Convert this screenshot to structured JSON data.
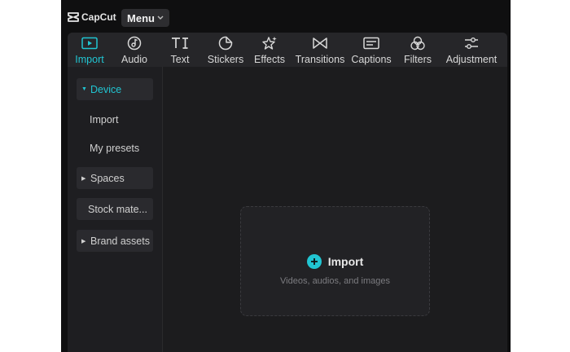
{
  "app": {
    "logo_text": "CapCut",
    "menu_label": "Menu"
  },
  "tabs": [
    {
      "label": "Import",
      "icon": "import-icon",
      "active": true
    },
    {
      "label": "Audio",
      "icon": "audio-icon"
    },
    {
      "label": "Text",
      "icon": "text-icon"
    },
    {
      "label": "Stickers",
      "icon": "stickers-icon"
    },
    {
      "label": "Effects",
      "icon": "effects-icon"
    },
    {
      "label": "Transitions",
      "icon": "transitions-icon"
    },
    {
      "label": "Captions",
      "icon": "captions-icon"
    },
    {
      "label": "Filters",
      "icon": "filters-icon"
    },
    {
      "label": "Adjustment",
      "icon": "adjustment-icon"
    }
  ],
  "sidebar": {
    "items": [
      {
        "label": "Device",
        "expanded": true
      },
      {
        "label": "Import"
      },
      {
        "label": "My presets"
      },
      {
        "label": "Spaces",
        "expanded": false
      },
      {
        "label": "Stock mate..."
      },
      {
        "label": "Brand assets",
        "expanded": false
      }
    ]
  },
  "dropzone": {
    "label": "Import",
    "hint": "Videos, audios, and images"
  },
  "colors": {
    "accent": "#21c5d2",
    "background": "#0f0f10",
    "panel": "#1c1c1e"
  }
}
